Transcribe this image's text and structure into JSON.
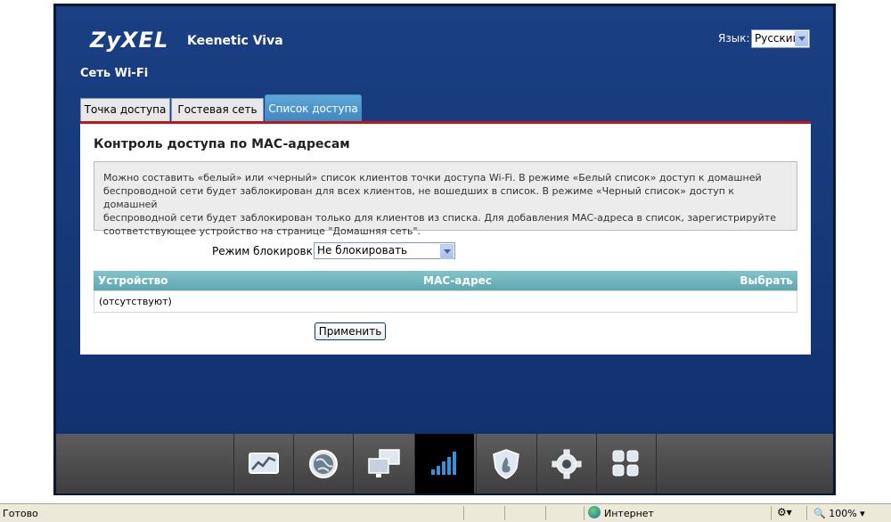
{
  "header": {
    "brand": "ZyXEL",
    "model": "Keenetic Viva",
    "language_label": "Язык:",
    "language_value": "Русский",
    "section_title": "Сеть Wi-Fi"
  },
  "tabs": [
    {
      "label": "Точка доступа",
      "active": false
    },
    {
      "label": "Гостевая сеть",
      "active": false
    },
    {
      "label": "Список доступа",
      "active": true
    }
  ],
  "content": {
    "title": "Контроль доступа по MAC-адресам",
    "info_lines": [
      "Можно составить «белый» или «черный» список клиентов точки доступа Wi-Fi. В режиме «Белый список» доступ к домашней",
      "беспроводной сети будет заблокирован для всех клиентов, не вошедших в список. В режиме «Черный список» доступ к домашней",
      "беспроводной сети будет заблокирован только для клиентов из списка. Для добавления MAC-адреса в список, зарегистрируйте",
      "соответствующее устройство на странице \"Домашняя сеть\"."
    ],
    "mode_label": "Режим блокировки:",
    "mode_value": "Не блокировать",
    "table": {
      "columns": [
        "Устройство",
        "MAC-адрес",
        "Выбрать"
      ],
      "empty_text": "(отсутствуют)"
    },
    "apply_label": "Применить"
  },
  "dock": [
    {
      "icon": "monitoring-chart-icon",
      "active": false
    },
    {
      "icon": "internet-globe-icon",
      "active": false
    },
    {
      "icon": "home-network-icon",
      "active": false
    },
    {
      "icon": "wifi-signal-icon",
      "active": true
    },
    {
      "icon": "security-shield-icon",
      "active": false
    },
    {
      "icon": "system-gear-icon",
      "active": false
    },
    {
      "icon": "apps-grid-icon",
      "active": false
    }
  ],
  "statusbar": {
    "ready": "Готово",
    "zone": "Интернет",
    "zoom": "100%"
  },
  "colors": {
    "panel_blue": "#163a7a",
    "tab_active": "#3f87c0",
    "accent_red": "#c0151c",
    "table_header": "#5fa8b0"
  }
}
